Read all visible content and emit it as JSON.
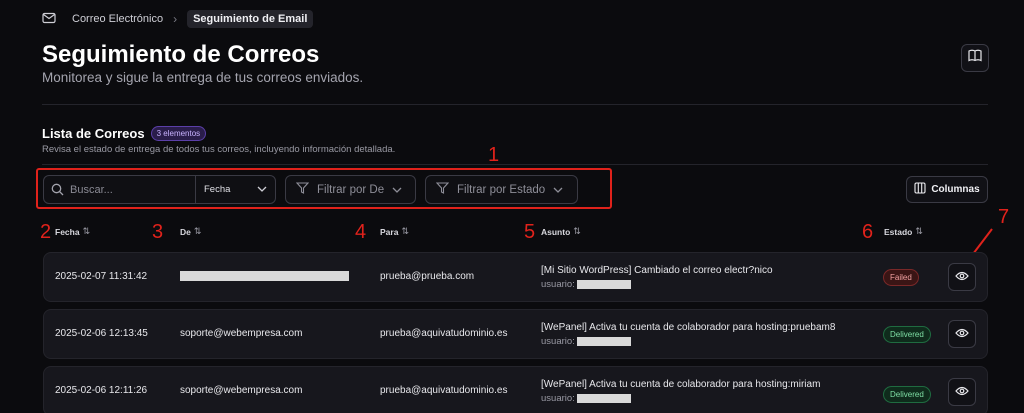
{
  "breadcrumb": {
    "root": "Correo Electrónico",
    "current": "Seguimiento de Email"
  },
  "header": {
    "title": "Seguimiento de Correos",
    "subtitle": "Monitorea y sigue la entrega de tus correos enviados."
  },
  "list": {
    "title": "Lista de Correos",
    "count_badge": "3 elementos",
    "description": "Revisa el estado de entrega de todos tus correos, incluyendo información detallada."
  },
  "toolbar": {
    "search_placeholder": "Buscar...",
    "date_select": "Fecha",
    "filter_from": "Filtrar por De",
    "filter_status": "Filtrar por Estado",
    "columns": "Columnas"
  },
  "columns": [
    "Fecha",
    "De",
    "Para",
    "Asunto",
    "Estado"
  ],
  "annotations": [
    "1",
    "2",
    "3",
    "4",
    "5",
    "6",
    "7"
  ],
  "rows": [
    {
      "date": "2025-02-07 11:31:42",
      "from": "",
      "to": "prueba@prueba.com",
      "subject": "[Mi Sitio WordPress] Cambiado el correo electr?nico",
      "user_label": "usuario:",
      "status": "Failed"
    },
    {
      "date": "2025-02-06 12:13:45",
      "from": "soporte@webempresa.com",
      "to": "prueba@aquivatudominio.es",
      "subject": "[WePanel] Activa tu cuenta de colaborador para hosting:pruebam8",
      "user_label": "usuario:",
      "status": "Delivered"
    },
    {
      "date": "2025-02-06 12:11:26",
      "from": "soporte@webempresa.com",
      "to": "prueba@aquivatudominio.es",
      "subject": "[WePanel] Activa tu cuenta de colaborador para hosting:miriam",
      "user_label": "usuario:",
      "status": "Delivered"
    }
  ],
  "colors": {
    "annotation": "#e0221b",
    "failed": "#f0a0a0",
    "delivered": "#7fe0a6",
    "badge": "#c9b3ff"
  },
  "icons": [
    "mail-icon",
    "chevron-right-icon",
    "book-icon",
    "search-icon",
    "chevron-down-icon",
    "filter-icon",
    "columns-icon",
    "sort-icon",
    "eye-icon",
    "arrow-icon"
  ]
}
